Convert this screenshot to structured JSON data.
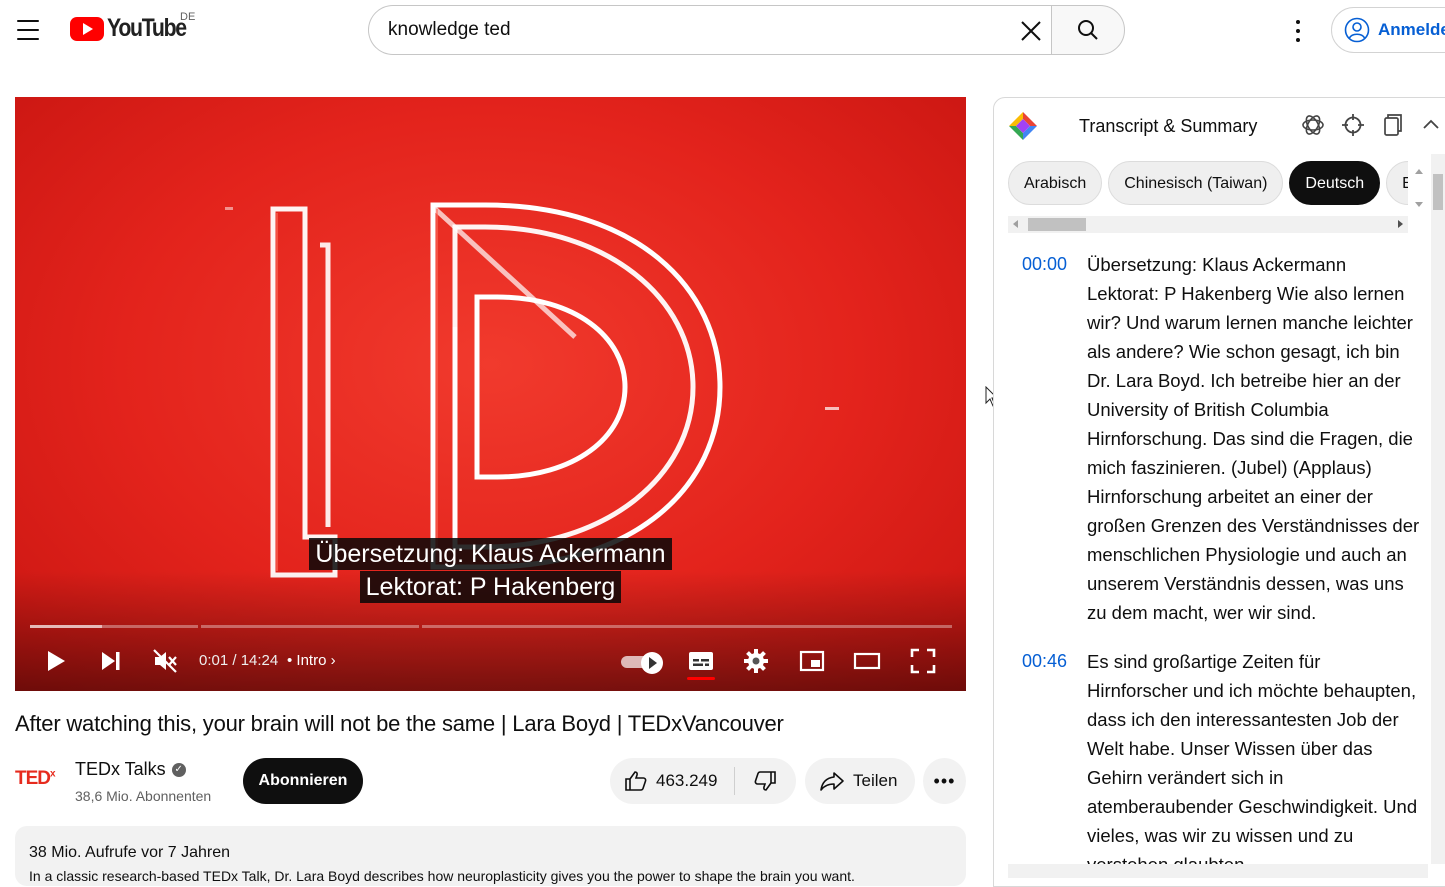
{
  "header": {
    "logo_text": "YouTube",
    "country": "DE",
    "search_value": "knowledge ted",
    "signin_label": "Anmelden"
  },
  "player": {
    "subtitle_line1": "Übersetzung: Klaus Ackermann",
    "subtitle_line2": "Lektorat: P Hakenberg",
    "time": "0:01 / 14:24",
    "chapter": "Intro",
    "progress_fraction": 0.0012
  },
  "video": {
    "title": "After watching this, your brain will not be the same | Lara Boyd | TEDxVancouver",
    "channel_logo": "TED",
    "channel_logo_sup": "x",
    "channel_name": "TEDx Talks",
    "subscribers": "38,6 Mio. Abonnenten",
    "subscribe_label": "Abonnieren",
    "likes": "463.249",
    "share_label": "Teilen",
    "more_label": "•••",
    "views_age": "38 Mio. Aufrufe  vor 7 Jahren",
    "description": "In a classic research-based TEDx Talk, Dr. Lara Boyd describes how neuroplasticity gives you the power to shape the brain you want."
  },
  "panel": {
    "title": "Transcript & Summary",
    "languages": [
      "Arabisch",
      "Chinesisch (Taiwan)",
      "Deutsch",
      "Englisch"
    ],
    "active_language": "Deutsch",
    "entries": [
      {
        "time": "00:00",
        "text": "Übersetzung: Klaus Ackermann Lektorat: P Hakenberg Wie also lernen wir? Und warum lernen manche leichter als andere? Wie schon gesagt, ich bin Dr. Lara Boyd. Ich betreibe hier an der University of British Columbia Hirnforschung. Das sind die Fragen, die mich faszinieren. (Jubel) (Applaus) Hirnforschung arbeitet an einer der großen Grenzen des Verständnisses der menschlichen Physiologie und auch an unserem Verständnis dessen, was uns zu dem macht, wer wir sind."
      },
      {
        "time": "00:46",
        "text": "Es sind großartige Zeiten für Hirnforscher und ich möchte behaupten, dass ich den interessantesten Job der Welt habe. Unser Wissen über das Gehirn verändert sich in atemberaubender Geschwindigkeit. Und vieles, was wir zu wissen und zu verstehen glaubten"
      }
    ]
  },
  "colors": {
    "brand_red": "#ff0000",
    "link_blue": "#065fd4",
    "video_red": "#e8261f"
  }
}
